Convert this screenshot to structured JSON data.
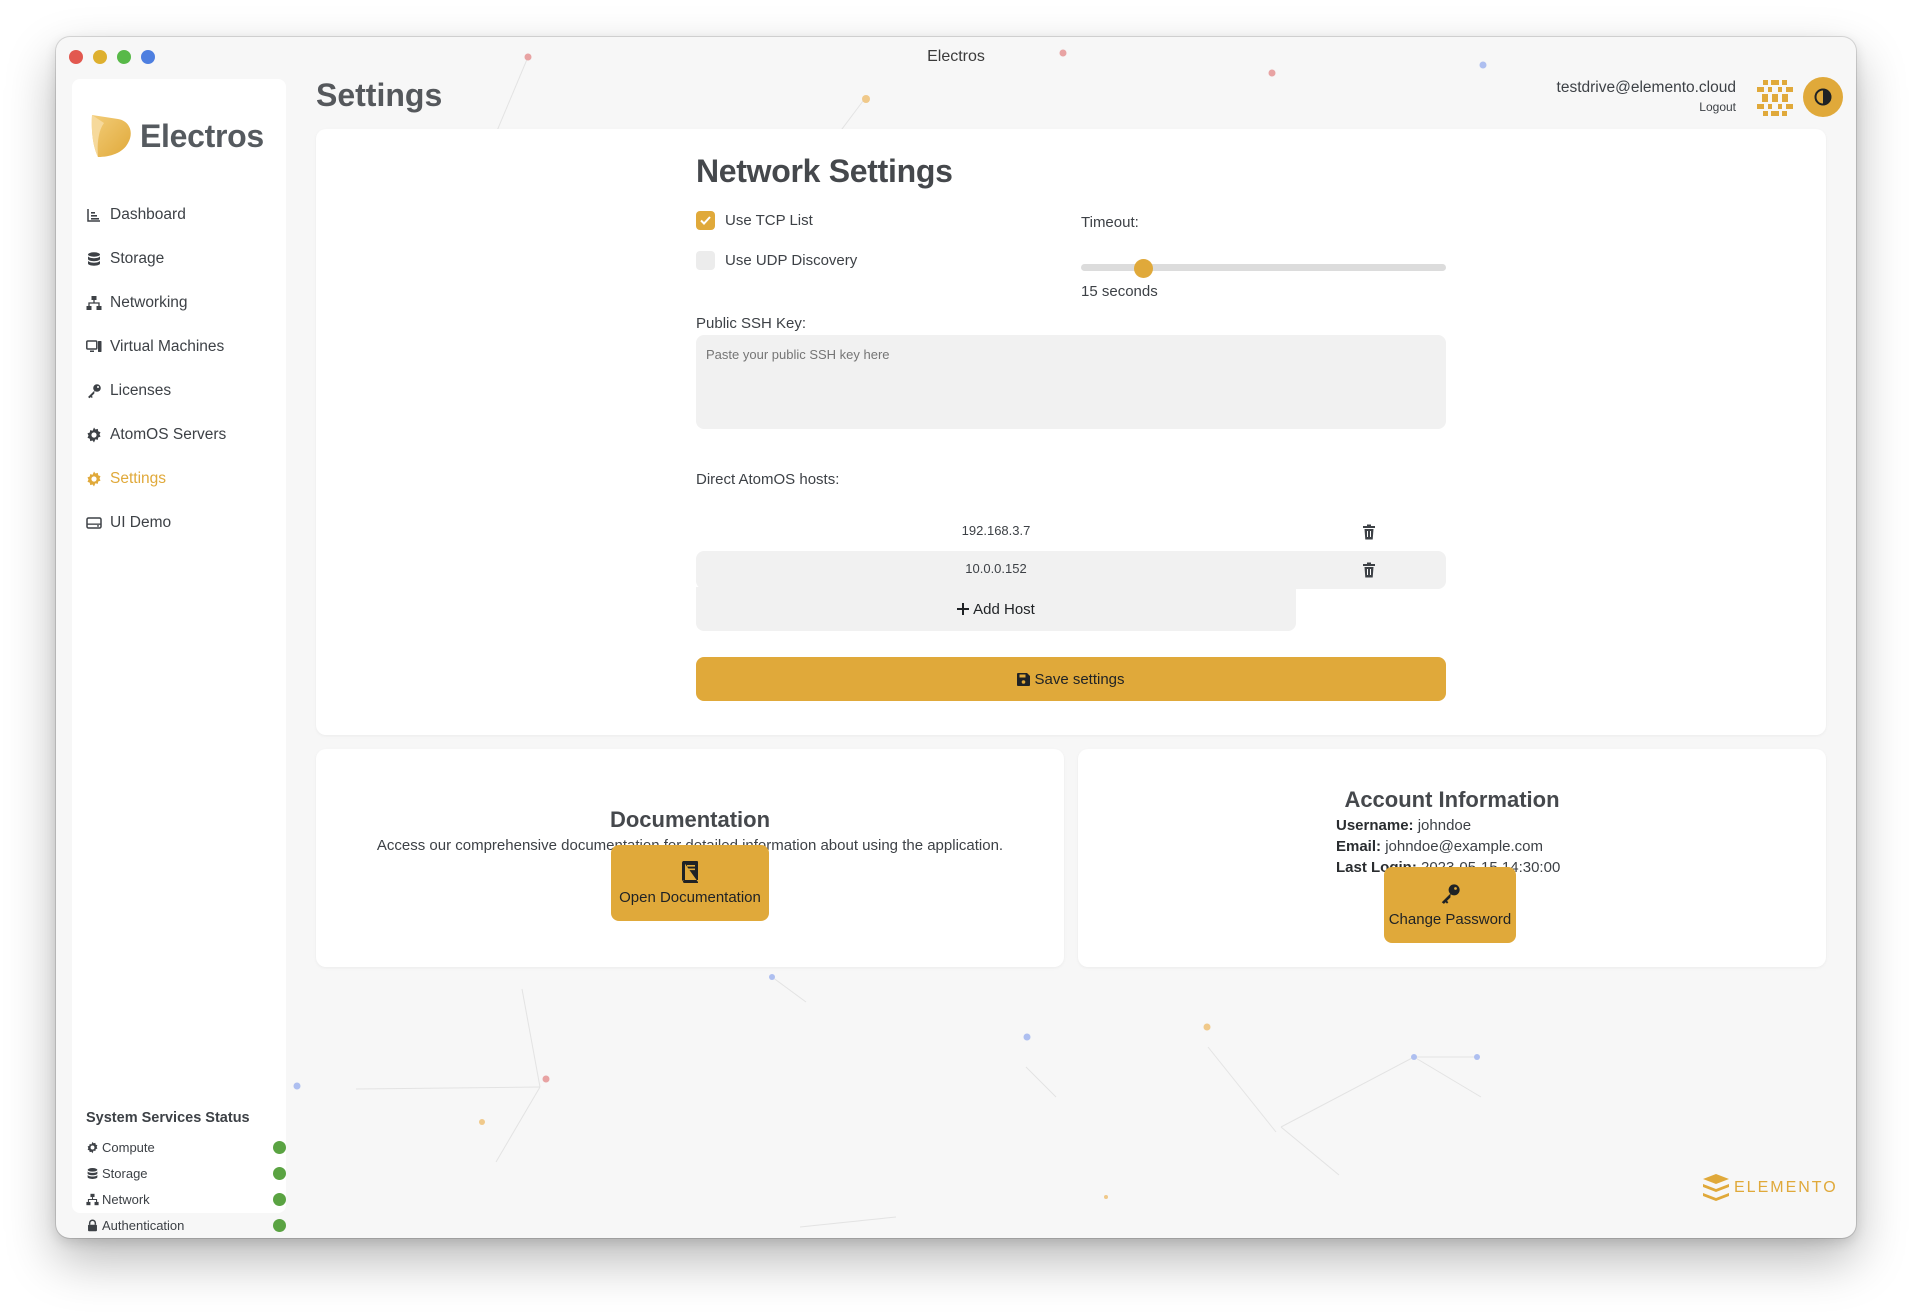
{
  "window": {
    "title": "Electros"
  },
  "brand": {
    "name": "Electros"
  },
  "sidebar": {
    "items": [
      {
        "label": "Dashboard",
        "icon": "chart-icon"
      },
      {
        "label": "Storage",
        "icon": "database-icon"
      },
      {
        "label": "Networking",
        "icon": "network-icon"
      },
      {
        "label": "Virtual Machines",
        "icon": "computer-icon"
      },
      {
        "label": "Licenses",
        "icon": "key-icon"
      },
      {
        "label": "AtomOS Servers",
        "icon": "gear-icon"
      },
      {
        "label": "Settings",
        "icon": "gear-icon",
        "active": true
      },
      {
        "label": "UI Demo",
        "icon": "hdd-icon"
      }
    ],
    "status": {
      "title": "System Services Status",
      "services": [
        {
          "label": "Compute",
          "icon": "chip-icon",
          "state": "online"
        },
        {
          "label": "Storage",
          "icon": "database-icon",
          "state": "online"
        },
        {
          "label": "Network",
          "icon": "network-icon",
          "state": "online"
        },
        {
          "label": "Authentication",
          "icon": "lock-icon",
          "state": "online"
        }
      ]
    }
  },
  "header": {
    "page_title": "Settings",
    "user_email": "testdrive@elemento.cloud",
    "logout_label": "Logout"
  },
  "network": {
    "title": "Network Settings",
    "use_tcp_label": "Use TCP List",
    "use_tcp_checked": true,
    "use_udp_label": "Use UDP Discovery",
    "use_udp_checked": false,
    "timeout_label": "Timeout:",
    "timeout_value": "15 seconds",
    "timeout_fraction": 0.17,
    "ssh_label": "Public SSH Key:",
    "ssh_placeholder": "Paste your public SSH key here",
    "hosts_label": "Direct AtomOS hosts:",
    "hosts": [
      "192.168.3.7",
      "10.0.0.152"
    ],
    "add_host_label": "Add Host",
    "save_label": "Save settings"
  },
  "documentation": {
    "title": "Documentation",
    "text": "Access our comprehensive documentation for detailed information about using the application.",
    "button_label": "Open Documentation"
  },
  "account": {
    "title": "Account Information",
    "username_key": "Username:",
    "username": "johndoe",
    "email_key": "Email:",
    "email": "johndoe@example.com",
    "last_login_key": "Last Login:",
    "last_login": "2023-05-15 14:30:00",
    "button_label": "Change Password"
  },
  "footer": {
    "logo_text": "ELEMENTO"
  },
  "colors": {
    "accent": "#e0a93a",
    "status_ok": "#5aa342",
    "text": "#3d4146"
  }
}
